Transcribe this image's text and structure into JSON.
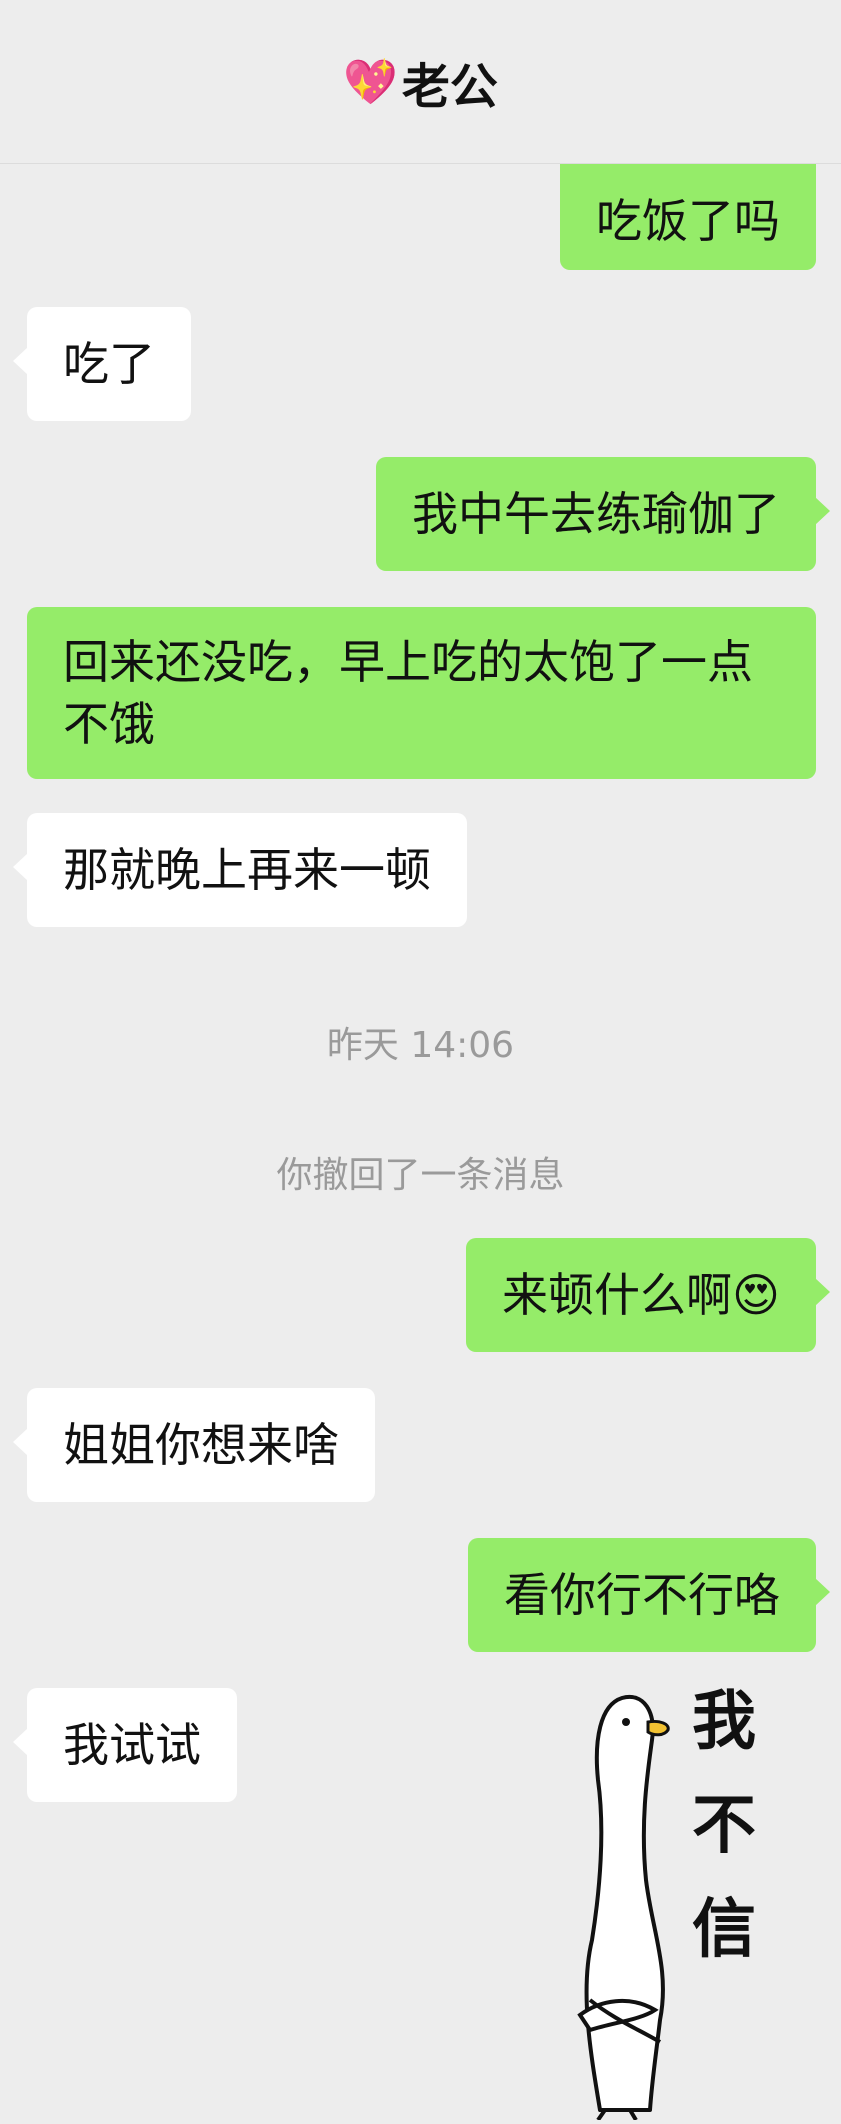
{
  "header": {
    "title_emoji": "💖",
    "title": "老公"
  },
  "messages": [
    {
      "side": "me",
      "text": "吃饭了吗"
    },
    {
      "side": "other",
      "text": "吃了"
    },
    {
      "side": "me",
      "text": "我中午去练瑜伽了"
    },
    {
      "side": "me",
      "text": "回来还没吃，早上吃的太饱了一点不饿"
    },
    {
      "side": "other",
      "text": "那就晚上再来一顿"
    },
    {
      "side": "me",
      "text": "来顿什么啊",
      "emoji": "😍"
    },
    {
      "side": "other",
      "text": "姐姐你想来啥"
    },
    {
      "side": "me",
      "text": "看你行不行咯"
    },
    {
      "side": "other",
      "text": "我试试"
    }
  ],
  "system": {
    "timestamp": "昨天 14:06",
    "recall_notice": "你撤回了一条消息"
  },
  "sticker": {
    "caption": "我不信",
    "icon": "goose-sticker-icon"
  },
  "colors": {
    "background": "#ededed",
    "me_bubble": "#95ec69",
    "other_bubble": "#ffffff"
  }
}
